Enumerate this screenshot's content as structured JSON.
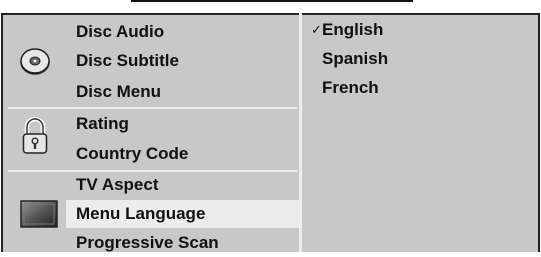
{
  "menu": {
    "items": [
      {
        "label": "Disc Audio"
      },
      {
        "label": "Disc Subtitle"
      },
      {
        "label": "Disc Menu"
      },
      {
        "label": "Rating"
      },
      {
        "label": "Country Code"
      },
      {
        "label": "TV Aspect"
      },
      {
        "label": "Menu Language"
      },
      {
        "label": "Progressive Scan"
      }
    ],
    "selected": "Menu Language"
  },
  "options": {
    "items": [
      "English",
      "Spanish",
      "French"
    ],
    "checked": "English",
    "check_glyph": "✓"
  },
  "icons": [
    "disc-icon",
    "lock-icon",
    "tv-screen-icon"
  ],
  "colors": {
    "panel": "#c8c8c8",
    "highlight": "#ececec",
    "separator": "#ededed",
    "text": "#111111"
  }
}
